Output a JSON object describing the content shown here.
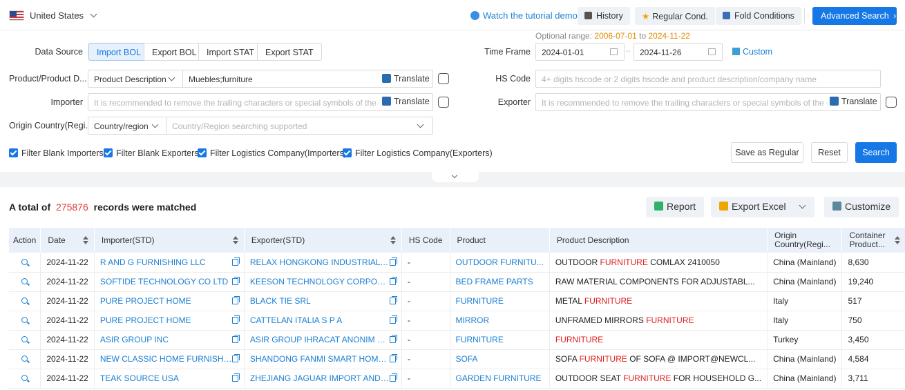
{
  "topbar": {
    "country": "United States",
    "tutorial": "Watch the tutorial demo",
    "history": "History",
    "regular_cond": "Regular Cond.",
    "fold_conditions": "Fold Conditions",
    "advanced_search": "Advanced Search"
  },
  "form": {
    "data_source_label": "Data Source",
    "data_sources": [
      "Import BOL",
      "Export BOL",
      "Import STAT",
      "Export STAT"
    ],
    "time_frame_label": "Time Frame",
    "optional_prefix": "Optional range:",
    "optional_start": "2006-07-01",
    "optional_to": "to",
    "optional_end": "2024-11-22",
    "date_start": "2024-01-01",
    "date_end": "2024-11-26",
    "custom": "Custom",
    "product_label": "Product/Product D...",
    "product_type": "Product Description",
    "product_value": "Muebles;furniture",
    "translate": "Translate",
    "hs_code_label": "HS Code",
    "hs_code_placeholder": "4+ digits hscode or 2 digits hscode and product description/company name",
    "importer_label": "Importer",
    "importer_placeholder": "It is recommended to remove the trailing characters or special symbols of the com",
    "exporter_label": "Exporter",
    "exporter_placeholder": "It is recommended to remove the trailing characters or special symbols of the com",
    "origin_label": "Origin Country(Regi...",
    "origin_type": "Country/region",
    "origin_placeholder": "Country/Region searching supported",
    "filters": [
      "Filter Blank Importers",
      "Filter Blank Exporters",
      "Filter Logistics Company(Importers)",
      "Filter Logistics Company(Exporters)"
    ],
    "save_regular": "Save as Regular",
    "reset": "Reset",
    "search": "Search"
  },
  "results": {
    "prefix": "A total of",
    "count": "275876",
    "suffix": "records were matched",
    "report": "Report",
    "export_excel": "Export Excel",
    "customize": "Customize"
  },
  "table": {
    "headers": [
      "Action",
      "Date",
      "Importer(STD)",
      "Exporter(STD)",
      "HS Code",
      "Product",
      "Product Description",
      "Origin Country(Regi...",
      "Container Product..."
    ],
    "rows": [
      {
        "date": "2024-11-22",
        "importer": "R AND G FURNISHING LLC",
        "exporter": "RELAX HONGKONG INDUSTRIAL C...",
        "hs": "-",
        "product": "OUTDOOR FURNITU...",
        "desc_pre": "OUTDOOR ",
        "desc_hl": "FURNITURE",
        "desc_post": " COMLAX 2410050",
        "origin": "China (Mainland)",
        "container": "8,630"
      },
      {
        "date": "2024-11-22",
        "importer": "SOFTIDE TECHNOLOGY CO LTD",
        "exporter": "KEESON TECHNOLOGY CORPORA...",
        "hs": "-",
        "product": "BED FRAME PARTS",
        "desc_pre": "RAW MATERIAL COMPONENTS FOR ADJUSTABL...",
        "desc_hl": "",
        "desc_post": "",
        "origin": "China (Mainland)",
        "container": "19,240"
      },
      {
        "date": "2024-11-22",
        "importer": "PURE PROJECT HOME",
        "exporter": "BLACK TIE SRL",
        "hs": "-",
        "product": "FURNITURE",
        "desc_pre": "METAL ",
        "desc_hl": "FURNITURE",
        "desc_post": "",
        "origin": "Italy",
        "container": "517"
      },
      {
        "date": "2024-11-22",
        "importer": "PURE PROJECT HOME",
        "exporter": "CATTELAN ITALIA S P A",
        "hs": "-",
        "product": "MIRROR",
        "desc_pre": "UNFRAMED MIRRORS ",
        "desc_hl": "FURNITURE",
        "desc_post": "",
        "origin": "Italy",
        "container": "750"
      },
      {
        "date": "2024-11-22",
        "importer": "ASIR GROUP INC",
        "exporter": "ASIR GROUP IHRACAT ANONIM SI...",
        "hs": "-",
        "product": "FURNITURE",
        "desc_pre": "",
        "desc_hl": "FURNITURE",
        "desc_post": "",
        "origin": "Turkey",
        "container": "3,450"
      },
      {
        "date": "2024-11-22",
        "importer": "NEW CLASSIC HOME FURNISHING",
        "exporter": "SHANDONG FANMI SMART HOME ...",
        "hs": "-",
        "product": "SOFA",
        "desc_pre": "SOFA ",
        "desc_hl": "FURNITURE",
        "desc_post": " OF SOFA @ IMPORT@NEWCL...",
        "origin": "China (Mainland)",
        "container": "4,584"
      },
      {
        "date": "2024-11-22",
        "importer": "TEAK SOURCE USA",
        "exporter": "ZHEJIANG JAGUAR IMPORT AND ...",
        "hs": "-",
        "product": "GARDEN FURNITURE",
        "desc_pre": "OUTDOOR SEAT ",
        "desc_hl": "FURNITURE",
        "desc_post": " FOR HOUSEHOLD G...",
        "origin": "China (Mainland)",
        "container": "3,711"
      }
    ]
  }
}
